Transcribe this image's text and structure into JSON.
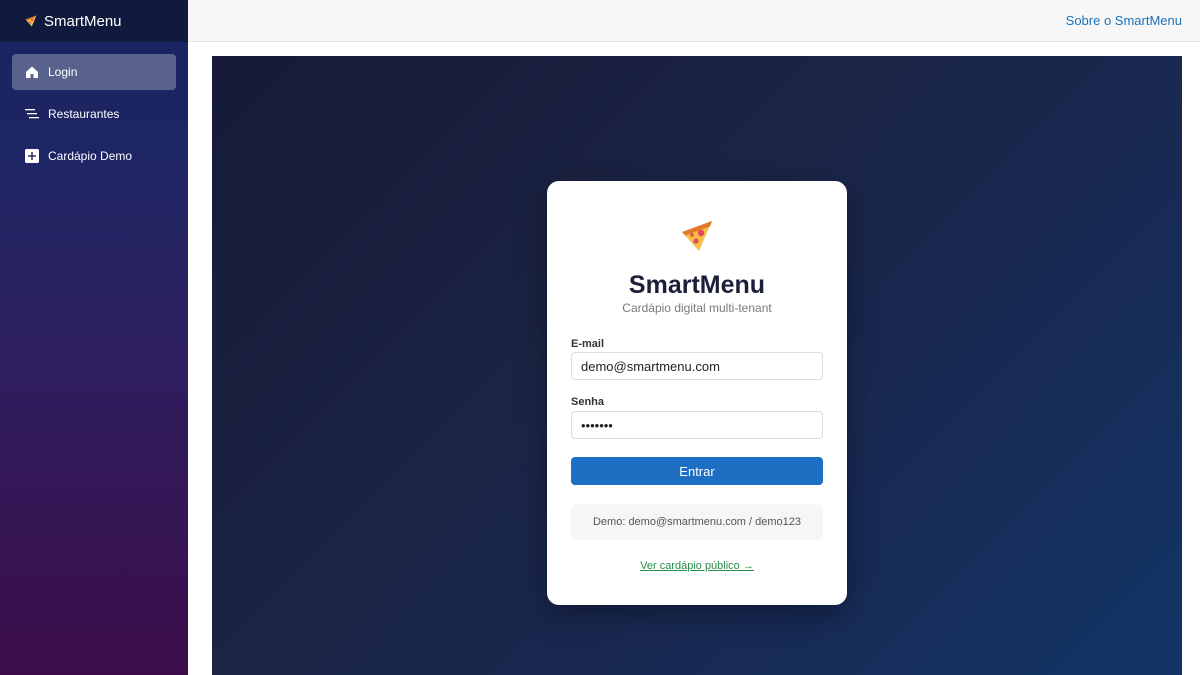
{
  "app": {
    "name": "SmartMenu",
    "brand_icon": "pizza-icon"
  },
  "sidebar": {
    "items": [
      {
        "label": "Login",
        "icon": "home-icon",
        "active": true
      },
      {
        "label": "Restaurantes",
        "icon": "list-icon",
        "active": false
      },
      {
        "label": "Cardápio Demo",
        "icon": "plus-square-icon",
        "active": false
      }
    ]
  },
  "topbar": {
    "about_link": "Sobre o SmartMenu"
  },
  "login": {
    "logo_icon": "pizza-icon",
    "title": "SmartMenu",
    "subtitle": "Cardápio digital multi-tenant",
    "email_label": "E-mail",
    "email_value": "demo@smartmenu.com",
    "password_label": "Senha",
    "password_value": "demo123",
    "submit_label": "Entrar",
    "demo_hint": "Demo: demo@smartmenu.com / demo123",
    "public_link": "Ver cardápio público →"
  },
  "colors": {
    "accent": "#1d6fc4",
    "link": "#1d72b8",
    "public_link": "#2a8a4a",
    "sidebar_top": "#16255f",
    "sidebar_bottom": "#3c0d4a"
  }
}
